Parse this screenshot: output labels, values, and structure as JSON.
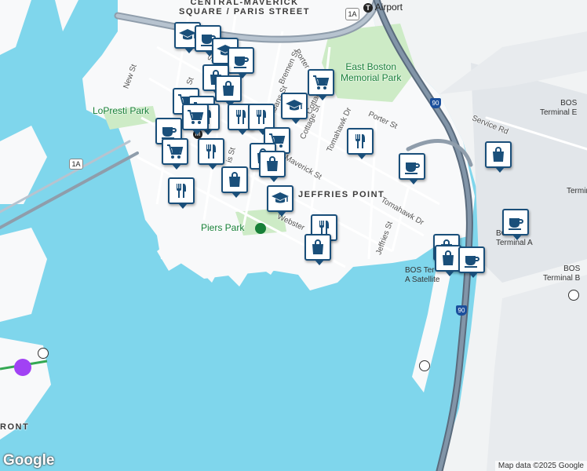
{
  "map": {
    "attribution": "Map data ©2025 Google",
    "logo": "Google",
    "neighborhoods": [
      {
        "line1": "CENTRAL-MAVERICK",
        "line2": "SQUARE / PARIS STREET"
      },
      {
        "line1": "JEFFRIES POINT"
      },
      {
        "line1": "RONT"
      }
    ],
    "parks": [
      "East Boston",
      "Memorial Park",
      "LoPresti Park",
      "Piers Park"
    ],
    "streets": [
      "New St",
      "Bremen St",
      "Porter St",
      "Cottage St",
      "Tomahawk Dr",
      "Porter St",
      "Maverick St",
      "Tomahawk Dr",
      "Jeffries St",
      "Webster",
      "Service Rd",
      "St",
      "St",
      "Orleans St",
      "Cottage St",
      "is St"
    ],
    "transit": {
      "airport_label": "Airport",
      "route_1a": "1A",
      "route_1a_south": "1A",
      "i90": "90",
      "i90_south": "90",
      "maverick_station": "M"
    },
    "terminals": [
      {
        "line1": "BOS",
        "line2": "Terminal E"
      },
      {
        "line1": "BOS",
        "line2": "Terminal A"
      },
      {
        "line1": "BOS Ter",
        "line2": "A Satellite"
      },
      {
        "line1": "BOS",
        "line2": "Terminal B"
      },
      {
        "line1": "Terminal"
      }
    ],
    "pins": [
      {
        "icon": "graduation-cap-icon"
      },
      {
        "icon": "coffee-icon"
      },
      {
        "icon": "graduation-cap-icon"
      },
      {
        "icon": "coffee-icon"
      },
      {
        "icon": "shopping-bag-icon"
      },
      {
        "icon": "shopping-bag-icon"
      },
      {
        "icon": "shopping-cart-icon"
      },
      {
        "icon": "graduation-cap-icon"
      },
      {
        "icon": "shopping-cart-icon"
      },
      {
        "icon": "shopping-cart-icon"
      },
      {
        "icon": "restaurant-icon"
      },
      {
        "icon": "restaurant-icon"
      },
      {
        "icon": "restaurant-icon"
      },
      {
        "icon": "coffee-icon"
      },
      {
        "icon": "shopping-cart-icon"
      },
      {
        "icon": "restaurant-icon"
      },
      {
        "icon": "restaurant-icon"
      },
      {
        "icon": "shopping-bag-icon"
      },
      {
        "icon": "shopping-cart-icon"
      },
      {
        "icon": "shopping-bag-icon"
      },
      {
        "icon": "shopping-bag-icon"
      },
      {
        "icon": "restaurant-icon"
      },
      {
        "icon": "graduation-cap-icon"
      },
      {
        "icon": "shopping-bag-icon"
      },
      {
        "icon": "restaurant-icon"
      },
      {
        "icon": "shopping-bag-icon"
      },
      {
        "icon": "coffee-icon"
      },
      {
        "icon": "shopping-bag-icon"
      },
      {
        "icon": "coffee-icon"
      },
      {
        "icon": "shopping-bag-icon"
      },
      {
        "icon": "coffee-icon"
      },
      {
        "icon": "shopping-cart-icon"
      }
    ]
  }
}
